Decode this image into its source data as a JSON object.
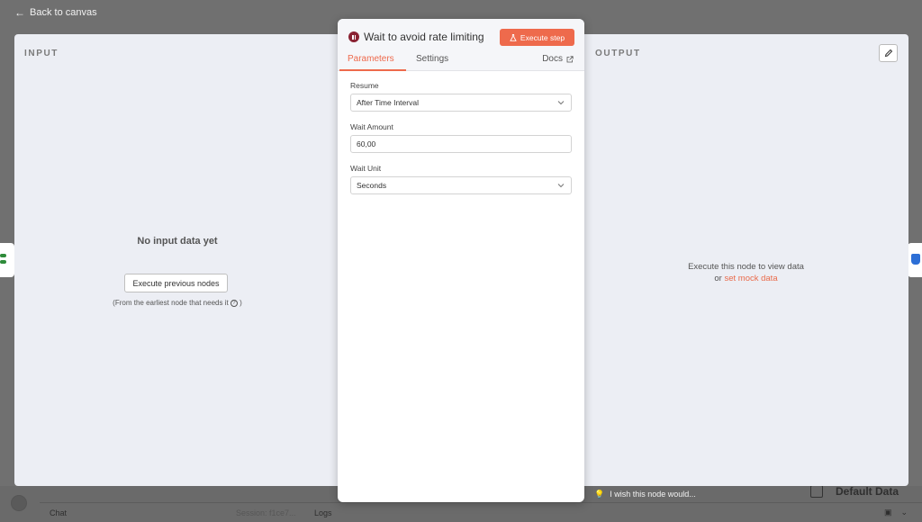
{
  "background": {
    "back_label": "Back to canvas",
    "bottom_bar": {
      "chat": "Chat",
      "session": "Session: f1ce7...",
      "logs": "Logs"
    },
    "default_data": "Default Data",
    "wish_text": "I wish this node would..."
  },
  "input_panel": {
    "title": "INPUT",
    "empty_title": "No input data yet",
    "execute_previous": "Execute previous nodes",
    "hint": "(From the earliest node that needs it",
    "hint_end": ")"
  },
  "output_panel": {
    "title": "OUTPUT",
    "message": "Execute this node to view data",
    "or": "or",
    "mock_link": "set mock data"
  },
  "node": {
    "title": "Wait to avoid rate limiting",
    "execute_step": "Execute step",
    "accent": "#ee6a4c",
    "tabs": {
      "parameters": "Parameters",
      "settings": "Settings",
      "docs": "Docs"
    },
    "fields": {
      "resume": {
        "label": "Resume",
        "value": "After Time Interval"
      },
      "wait_amount": {
        "label": "Wait Amount",
        "value": "60,00"
      },
      "wait_unit": {
        "label": "Wait Unit",
        "value": "Seconds"
      }
    }
  }
}
